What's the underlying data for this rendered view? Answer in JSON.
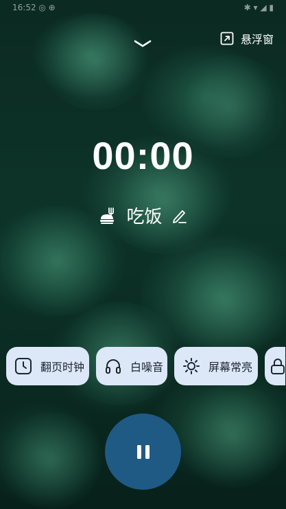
{
  "status_bar": {
    "left_text": "16:52 ◎ ⊕",
    "right_text": "✱ ▾ ◢ ▮"
  },
  "header": {
    "collapse_icon": "chevron-down-icon",
    "float_window_icon": "open-external-icon",
    "float_window_label": "悬浮窗"
  },
  "timer": {
    "display": "00:00"
  },
  "task": {
    "icon": "meal-icon",
    "label": "吃饭",
    "edit_icon": "pencil-icon"
  },
  "chips": [
    {
      "icon": "clock-icon",
      "label": "翻页时钟"
    },
    {
      "icon": "headphones-icon",
      "label": "白噪音"
    },
    {
      "icon": "sun-icon",
      "label": "屏幕常亮"
    },
    {
      "icon": "lock-icon",
      "label": ""
    }
  ],
  "controls": {
    "pause_icon": "pause-icon"
  },
  "colors": {
    "chip_bg": "#dce7f7",
    "chip_text": "#1b2430",
    "pause_button": "#1f5a85",
    "background": "#0d3328"
  }
}
